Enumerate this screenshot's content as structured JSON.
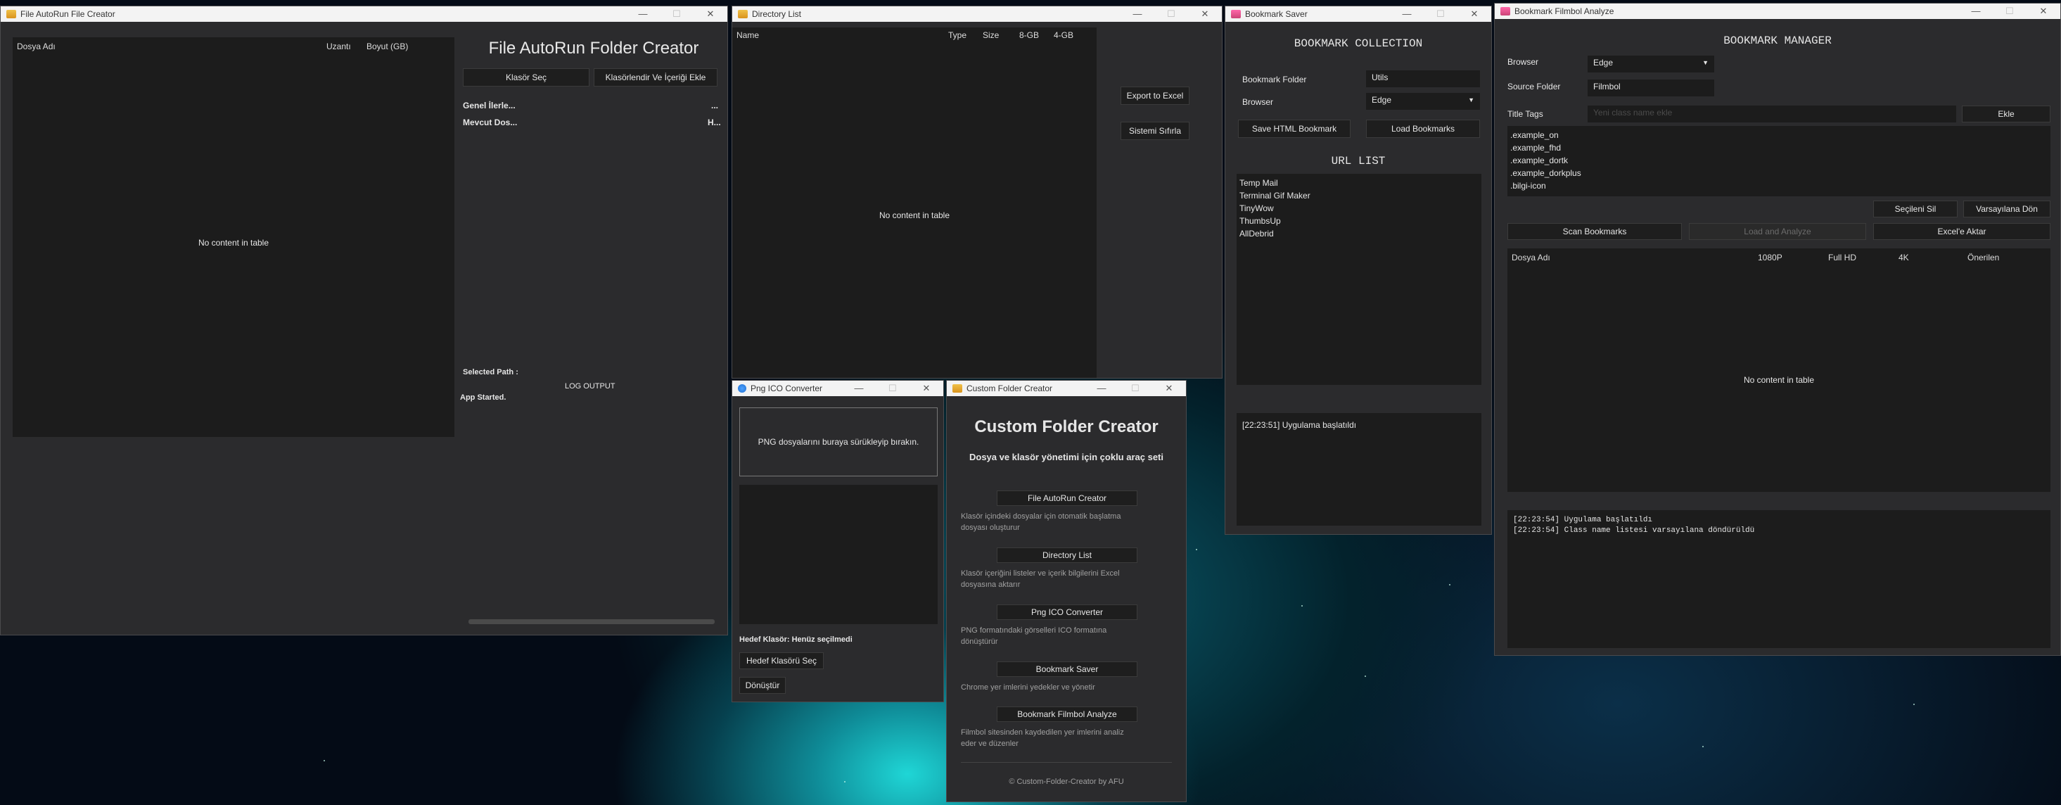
{
  "win_autorun": {
    "title": "File AutoRun File Creator",
    "col1": "Dosya Adı",
    "col2": "Uzantı",
    "col3": "Boyut (GB)",
    "empty": "No content in table",
    "heading": "File AutoRun Folder Creator",
    "btn_select": "Klasör Seç",
    "btn_folderize": "Klasörlendir Ve İçeriği Ekle",
    "info1_label": "Genel İlerle...",
    "info1_value": "...",
    "info2_label": "Mevcut Dos...",
    "info2_value": "H...",
    "selected_path": "Selected Path :",
    "log_title": "LOG OUTPUT",
    "log_text": "App Started."
  },
  "win_dirlist": {
    "title": "Directory List",
    "col_name": "Name",
    "col_type": "Type",
    "col_size": "Size",
    "col_8gb": "8-GB",
    "col_4gb": "4-GB",
    "empty": "No content in table",
    "btn_export": "Export to Excel",
    "btn_reset": "Sistemi Sıfırla"
  },
  "win_bookmark": {
    "title": "Bookmark Saver",
    "heading": "BOOKMARK COLLECTION",
    "folder_label": "Bookmark Folder",
    "folder_value": "Utils",
    "browser_label": "Browser",
    "browser_value": "Edge",
    "btn_save": "Save HTML Bookmark",
    "btn_load": "Load Bookmarks",
    "url_heading": "URL LIST",
    "urls": [
      "Temp Mail",
      "Terminal Gif Maker",
      "TinyWow",
      "ThumbsUp",
      "AllDebrid"
    ],
    "log": "[22:23:51] Uygulama başlatıldı"
  },
  "win_filmbol": {
    "title": "Bookmark Filmbol Analyze",
    "heading": "BOOKMARK MANAGER",
    "browser_label": "Browser",
    "browser_value": "Edge",
    "source_label": "Source Folder",
    "source_value": "Filmbol",
    "tags_label": "Title Tags",
    "tags_placeholder": "Yeni class name ekle",
    "btn_add": "Ekle",
    "tags": [
      ".example_on",
      ".example_fhd",
      ".example_dortk",
      ".example_dorkplus",
      ".bilgi-icon"
    ],
    "btn_delete": "Seçileni Sil",
    "btn_default": "Varsayılana Dön",
    "btn_scan": "Scan Bookmarks",
    "btn_analyze": "Load and Analyze",
    "btn_excel": "Excel'e Aktar",
    "col_file": "Dosya Adı",
    "col_1080": "1080P",
    "col_fhd": "Full HD",
    "col_4k": "4K",
    "col_rec": "Önerilen",
    "empty": "No content in table",
    "log1": "[22:23:54] Uygulama başlatıldı",
    "log2": "[22:23:54] Class name listesi varsayılana döndürüldü"
  },
  "win_png": {
    "title": "Png ICO Converter",
    "drop": "PNG dosyalarını buraya sürükleyip bırakın.",
    "target": "Hedef Klasör: Henüz seçilmedi",
    "btn_select": "Hedef Klasörü Seç",
    "btn_convert": "Dönüştür"
  },
  "win_custom": {
    "title": "Custom Folder Creator",
    "heading": "Custom Folder Creator",
    "subheading": "Dosya ve klasör yönetimi için çoklu araç seti",
    "tools": [
      {
        "label": "File AutoRun Creator",
        "desc1": "Klasör içindeki dosyalar için otomatik başlatma",
        "desc2": "dosyası oluşturur"
      },
      {
        "label": "Directory List",
        "desc1": "Klasör içeriğini listeler ve içerik bilgilerini Excel",
        "desc2": "dosyasına aktarır"
      },
      {
        "label": "Png ICO Converter",
        "desc1": "PNG formatındaki görselleri ICO formatına",
        "desc2": "dönüştürür"
      },
      {
        "label": "Bookmark Saver",
        "desc1": "Chrome yer imlerini yedekler ve yönetir",
        "desc2": ""
      },
      {
        "label": "Bookmark Filmbol Analyze",
        "desc1": "Filmbol sitesinden kaydedilen yer imlerini analiz",
        "desc2": "eder ve düzenler"
      }
    ],
    "footer": "© Custom-Folder-Creator by AFU"
  },
  "window_controls": {
    "minimize": "—",
    "maximize": "☐",
    "close": "✕"
  }
}
